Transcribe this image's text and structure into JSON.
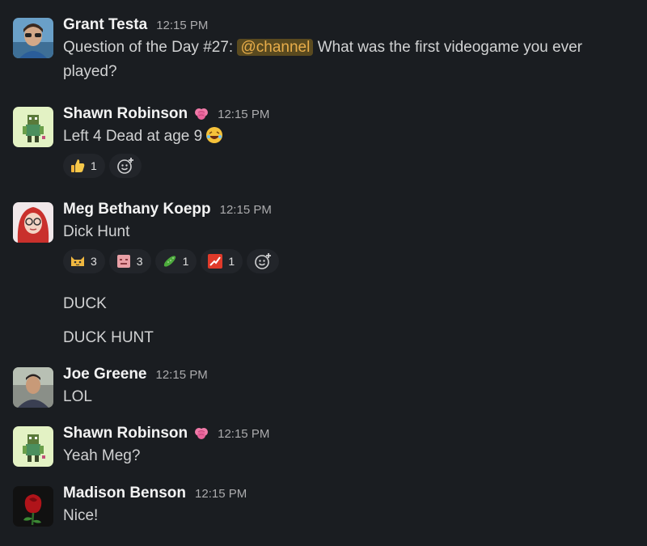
{
  "messages": [
    {
      "name": "Grant Testa",
      "time": "12:15 PM",
      "text_before": "Question of the Day #27: ",
      "mention": "@channel",
      "text_after": " What was the first videogame you ever played?"
    },
    {
      "name": "Shawn Robinson",
      "time": "12:15 PM",
      "text": "Left 4 Dead at age 9",
      "reactions": [
        {
          "icon": "thumbs-up-icon",
          "count": "1"
        }
      ]
    },
    {
      "name": "Meg Bethany Koepp",
      "time": "12:15 PM",
      "text": "Dick Hunt",
      "reactions": [
        {
          "icon": "cat-emoji-icon",
          "count": "3"
        },
        {
          "icon": "pink-face-emoji-icon",
          "count": "3"
        },
        {
          "icon": "cucumber-emoji-icon",
          "count": "1"
        },
        {
          "icon": "graph-emoji-icon",
          "count": "1"
        }
      ]
    },
    {
      "text": "DUCK"
    },
    {
      "text": "DUCK HUNT"
    },
    {
      "name": "Joe Greene",
      "time": "12:15 PM",
      "text": "LOL"
    },
    {
      "name": "Shawn Robinson",
      "time": "12:15 PM",
      "text": "Yeah Meg?"
    },
    {
      "name": "Madison Benson",
      "time": "12:15 PM",
      "text": "Nice!"
    }
  ],
  "colors": {
    "background": "#1a1d21",
    "mention_bg": "#5a4a1f",
    "mention_text": "#e8ad4a",
    "timestamp": "#ababad"
  }
}
